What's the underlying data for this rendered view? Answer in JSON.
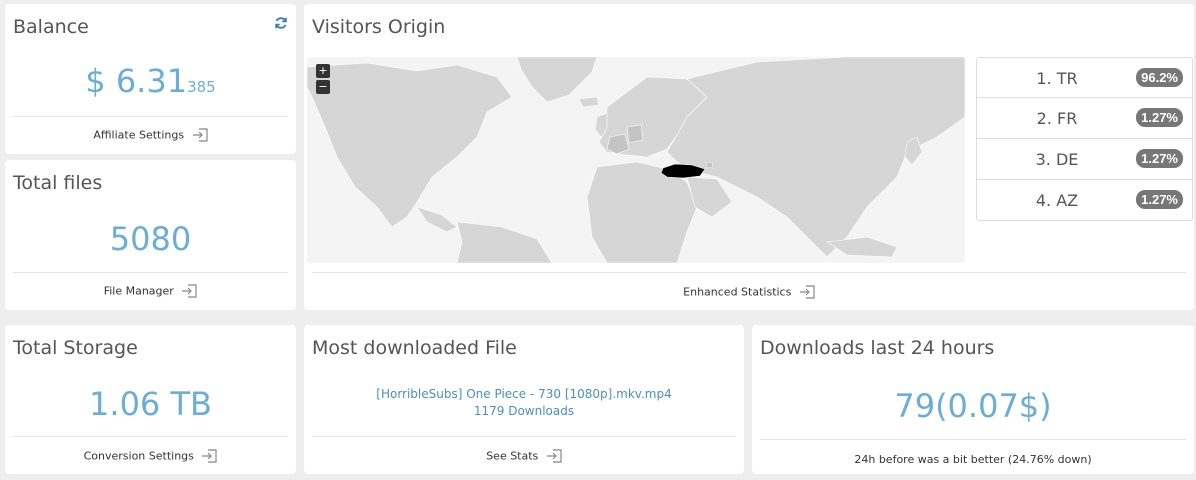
{
  "balance": {
    "title": "Balance",
    "value_main": "$ 6.31",
    "value_small": "385",
    "link": "Affiliate Settings"
  },
  "total_files": {
    "title": "Total files",
    "value": "5080",
    "link": "File Manager"
  },
  "visitors": {
    "title": "Visitors Origin",
    "zoom_in": "+",
    "zoom_out": "−",
    "link": "Enhanced Statistics",
    "countries": [
      {
        "label": "1. TR",
        "pct": "96.2%"
      },
      {
        "label": "2. FR",
        "pct": "1.27%"
      },
      {
        "label": "3. DE",
        "pct": "1.27%"
      },
      {
        "label": "4. AZ",
        "pct": "1.27%"
      }
    ]
  },
  "total_storage": {
    "title": "Total Storage",
    "value": "1.06 TB",
    "link": "Conversion Settings"
  },
  "most_downloaded": {
    "title": "Most downloaded File",
    "file_name": "[HorribleSubs] One Piece - 730 [1080p].mkv.mp4",
    "downloads": "1179 Downloads",
    "link": "See Stats"
  },
  "downloads_24h": {
    "title": "Downloads last 24 hours",
    "value": "79(0.07$)",
    "note": "24h before was a bit better (24.76% down)"
  },
  "colors": {
    "accent": "#6aaed6",
    "badge": "#777777",
    "map_land": "#d6d6d6",
    "map_highlight": "#000000"
  }
}
